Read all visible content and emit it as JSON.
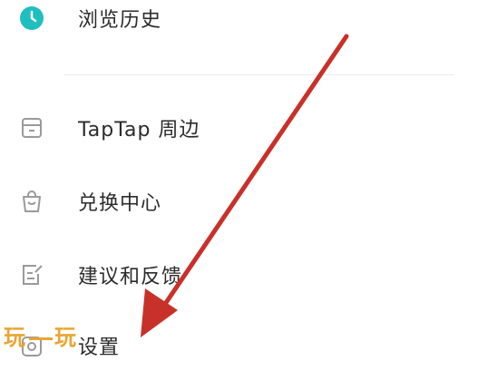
{
  "menu": {
    "items": [
      {
        "label": "浏览历史",
        "icon": "clock-icon"
      },
      {
        "label": "TapTap 周边",
        "icon": "store-icon"
      },
      {
        "label": "兑换中心",
        "icon": "bag-icon"
      },
      {
        "label": "建议和反馈",
        "icon": "feedback-edit-icon"
      },
      {
        "label": "设置",
        "icon": "settings-icon"
      }
    ]
  },
  "annotation": {
    "arrow_color": "#c8312a"
  },
  "watermark": {
    "left": "玩",
    "right": "玩"
  },
  "colors": {
    "accent": "#1fbfbf",
    "text": "#2b2b2b",
    "icon_gray": "#9a9a9a"
  }
}
